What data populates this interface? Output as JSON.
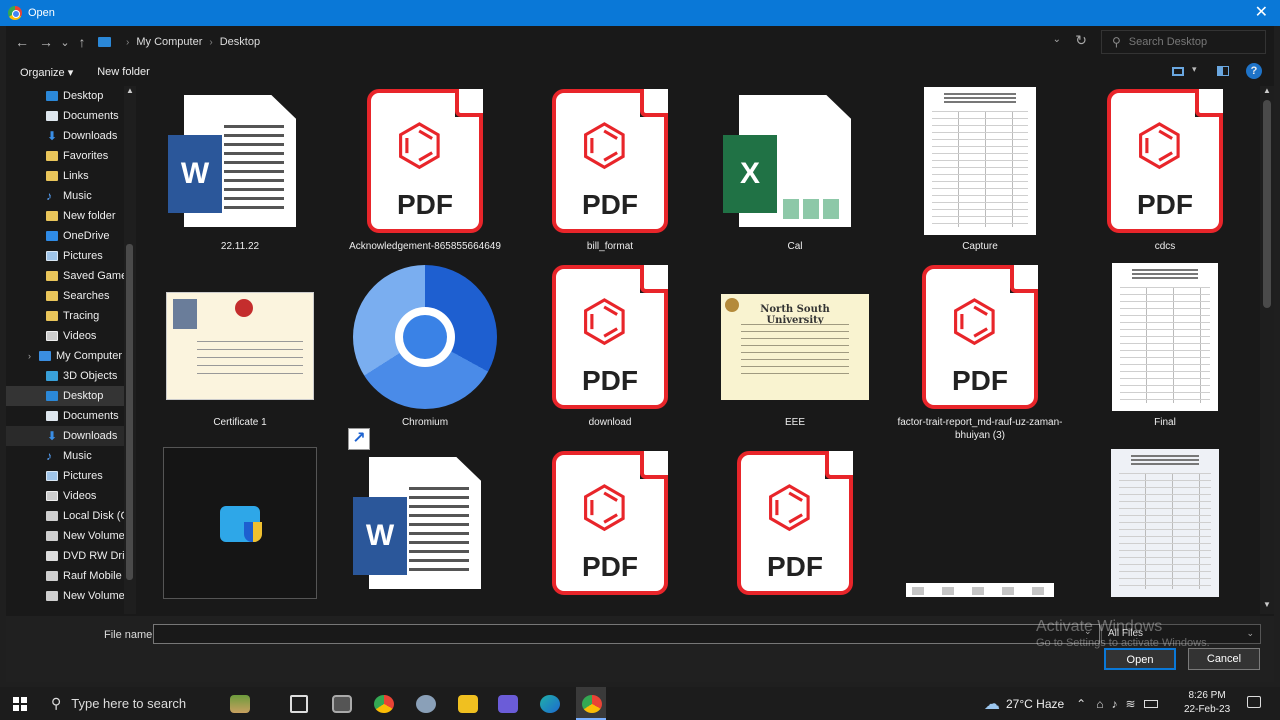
{
  "window": {
    "title": "Open",
    "close_glyph": "✕"
  },
  "nav": {
    "back": "←",
    "forward": "→",
    "recent": "⌄",
    "up": "↑"
  },
  "address": {
    "parts": [
      "My Computer",
      "Desktop"
    ],
    "separator": "›",
    "refresh_glyph": "↻"
  },
  "search": {
    "placeholder": "Search Desktop",
    "icon": "search-icon"
  },
  "toolbar": {
    "organize": "Organize ▾",
    "new_folder": "New folder",
    "help": "?"
  },
  "sidebar": {
    "items": [
      {
        "label": "Desktop",
        "icon": "desktop-icon"
      },
      {
        "label": "Documents",
        "icon": "documents-icon"
      },
      {
        "label": "Downloads",
        "icon": "downloads-icon"
      },
      {
        "label": "Favorites",
        "icon": "folder-icon"
      },
      {
        "label": "Links",
        "icon": "folder-icon"
      },
      {
        "label": "Music",
        "icon": "music-icon"
      },
      {
        "label": "New folder",
        "icon": "folder-icon"
      },
      {
        "label": "OneDrive",
        "icon": "cloud-icon"
      },
      {
        "label": "Pictures",
        "icon": "pictures-icon"
      },
      {
        "label": "Saved Games",
        "icon": "folder-icon"
      },
      {
        "label": "Searches",
        "icon": "folder-icon"
      },
      {
        "label": "Tracing",
        "icon": "folder-icon"
      },
      {
        "label": "Videos",
        "icon": "videos-icon"
      },
      {
        "label": "My Computer",
        "icon": "computer-icon"
      },
      {
        "label": "3D Objects",
        "icon": "3d-objects-icon"
      },
      {
        "label": "Desktop",
        "icon": "desktop-icon"
      },
      {
        "label": "Documents",
        "icon": "documents-icon"
      },
      {
        "label": "Downloads",
        "icon": "downloads-icon"
      },
      {
        "label": "Music",
        "icon": "music-icon"
      },
      {
        "label": "Pictures",
        "icon": "pictures-icon"
      },
      {
        "label": "Videos",
        "icon": "videos-icon"
      },
      {
        "label": "Local Disk (C:)",
        "icon": "drive-icon"
      },
      {
        "label": "New Volume (D",
        "icon": "drive-icon"
      },
      {
        "label": "DVD RW Drive",
        "icon": "dvd-icon"
      },
      {
        "label": "Rauf Mobile (F:",
        "icon": "drive-icon"
      },
      {
        "label": "New Volume (G",
        "icon": "drive-icon"
      }
    ]
  },
  "files": [
    {
      "name": "22.11.22",
      "type": "word"
    },
    {
      "name": "Acknowledgement-865855664649",
      "type": "pdf"
    },
    {
      "name": "bill_format",
      "type": "pdf"
    },
    {
      "name": "Cal",
      "type": "excel"
    },
    {
      "name": "Capture",
      "type": "image"
    },
    {
      "name": "cdcs",
      "type": "pdf"
    },
    {
      "name": "Certificate 1",
      "type": "image"
    },
    {
      "name": "Chromium",
      "type": "shortcut"
    },
    {
      "name": "download",
      "type": "pdf"
    },
    {
      "name": "EEE",
      "type": "image"
    },
    {
      "name": "factor-trait-report_md-rauf-uz-zaman-bhuiyan (3)",
      "type": "pdf"
    },
    {
      "name": "Final",
      "type": "image"
    },
    {
      "name": "",
      "type": "shortcut"
    },
    {
      "name": "",
      "type": "word"
    },
    {
      "name": "",
      "type": "pdf"
    },
    {
      "name": "",
      "type": "pdf"
    },
    {
      "name": "",
      "type": "image"
    },
    {
      "name": "",
      "type": "image"
    }
  ],
  "thumb_text": {
    "pdf": "PDF",
    "word": "W",
    "excel": "X",
    "diploma": "North South University"
  },
  "bottom": {
    "filename_label": "File name:",
    "filename_value": "",
    "filter": "All Files",
    "open": "Open",
    "cancel": "Cancel"
  },
  "watermark": {
    "line1": "Activate Windows",
    "line2": "Go to Settings to activate Windows."
  },
  "taskbar": {
    "search_placeholder": "Type here to search",
    "weather": "27°C  Haze",
    "time": "8:26 PM",
    "date": "22-Feb-23"
  },
  "colors": {
    "accent": "#0a78d7",
    "pdf_red": "#e8252a",
    "word_blue": "#2b579a",
    "excel_green": "#207245"
  }
}
